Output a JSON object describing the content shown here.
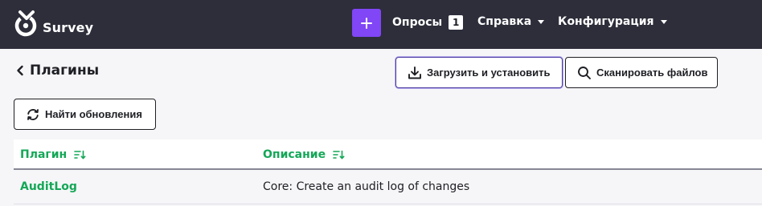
{
  "navbar": {
    "brand": "Survey",
    "brand_icon": "survey-logo-icon",
    "plus_icon": "plus-icon",
    "plus_color": "#8146f6",
    "background": "#2d2e3a",
    "surveys_label": "Опросы",
    "surveys_count": "1",
    "help_label": "Справка",
    "config_label": "Конфигурация"
  },
  "header": {
    "back_icon": "chevron-left-icon",
    "title": "Плагины"
  },
  "toolbar": {
    "upload_label": "Загрузить и установить",
    "upload_icon": "download-icon",
    "scan_label": "Сканировать файлов",
    "scan_icon": "search-icon",
    "updates_label": "Найти обновления",
    "updates_icon": "refresh-icon"
  },
  "table": {
    "accent_color": "#14a757",
    "columns": [
      "Плагин",
      "Описание"
    ],
    "sort_icon": "sort-icon",
    "rows": [
      {
        "name": "AuditLog",
        "description": "Core: Create an audit log of changes"
      }
    ]
  }
}
